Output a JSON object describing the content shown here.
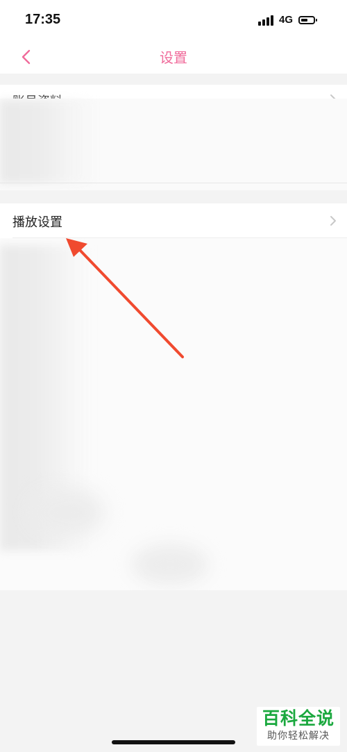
{
  "status_bar": {
    "time": "17:35",
    "network": "4G"
  },
  "nav": {
    "title": "设置",
    "back_icon": "chevron-left-icon"
  },
  "section_a": {
    "rows": [
      {
        "label": "账号资料"
      }
    ]
  },
  "play_settings": {
    "label": "播放设置"
  },
  "watermark": {
    "title": "百科全说",
    "subtitle": "助你轻松解决"
  },
  "colors": {
    "accent": "#f06b9b",
    "arrow": "#f04a2f",
    "watermark_green": "#1aa83e"
  }
}
